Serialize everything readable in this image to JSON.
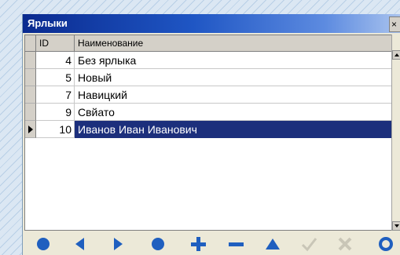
{
  "window": {
    "title": "Ярлыки",
    "close_glyph": "×"
  },
  "grid": {
    "columns": [
      "ID",
      "Наименование"
    ],
    "rows": [
      {
        "id": "4",
        "name": "Без ярлыка",
        "selected": false
      },
      {
        "id": "5",
        "name": "Новый",
        "selected": false
      },
      {
        "id": "7",
        "name": "Навицкий",
        "selected": false
      },
      {
        "id": "9",
        "name": "Свйато",
        "selected": false
      },
      {
        "id": "10",
        "name": "Иванов Иван Иванович",
        "selected": true
      }
    ]
  },
  "navigator": {
    "buttons": [
      "first-icon",
      "prior-icon",
      "next-icon",
      "last-icon",
      "insert-icon",
      "delete-icon",
      "edit-icon",
      "post-icon",
      "cancel-icon",
      "refresh-icon"
    ],
    "enabled_color": "#1f5fbf",
    "disabled_color": "#c9c6b7"
  },
  "colors": {
    "selection": "#1c2f7c",
    "title_start": "#0a2a8f",
    "title_end": "#a9c3ee"
  }
}
